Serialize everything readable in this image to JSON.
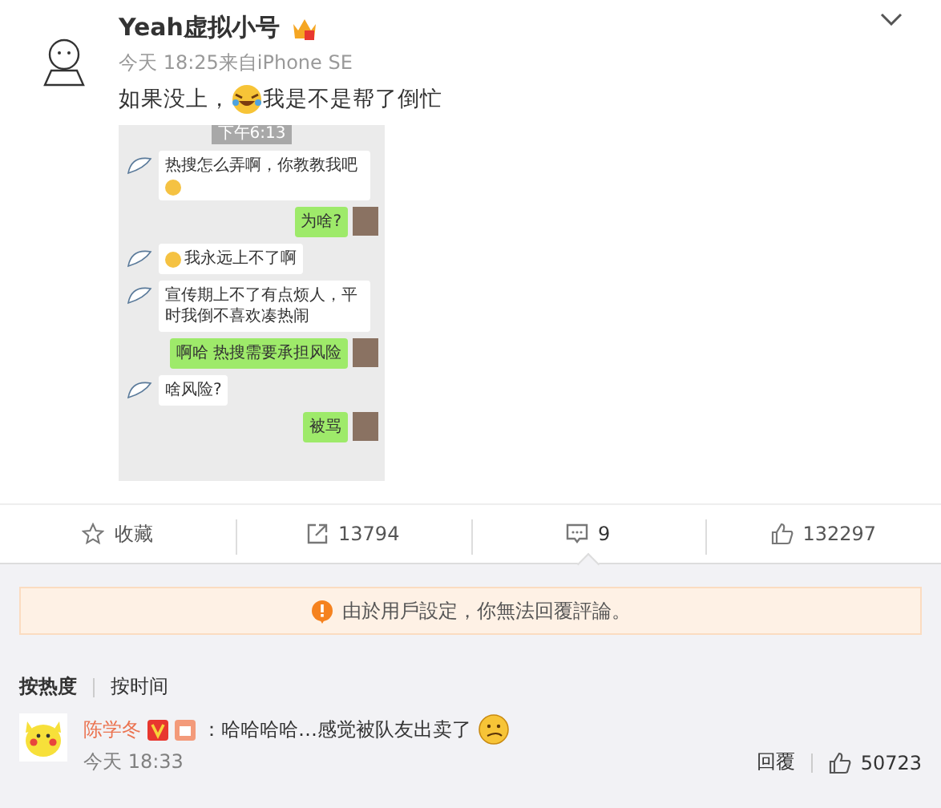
{
  "post": {
    "author": "Yeah虚拟小号",
    "meta": "今天 18:25来自iPhone SE",
    "text_before": "如果没上，",
    "text_after": "我是不是帮了倒忙",
    "chat": {
      "time": "下午6:13",
      "messages": [
        {
          "kind": "in",
          "text": "热搜怎么弄啊，你教教我吧",
          "emoji_before": false,
          "emoji_after": true
        },
        {
          "kind": "out",
          "text": "为啥?",
          "emoji_before": false,
          "emoji_after": false
        },
        {
          "kind": "in",
          "text": "我永远上不了啊",
          "emoji_before": true,
          "emoji_after": false
        },
        {
          "kind": "in",
          "text": "宣传期上不了有点烦人，平时我倒不喜欢凑热闹",
          "emoji_before": false,
          "emoji_after": false
        },
        {
          "kind": "out",
          "text": "啊哈 热搜需要承担风险",
          "emoji_before": false,
          "emoji_after": false
        },
        {
          "kind": "in",
          "text": "啥风险?",
          "emoji_before": false,
          "emoji_after": false
        },
        {
          "kind": "out",
          "text": "被骂",
          "emoji_before": false,
          "emoji_after": false
        }
      ]
    }
  },
  "actions": [
    {
      "kind": "favorite",
      "label": "收藏",
      "selected": false
    },
    {
      "kind": "repost",
      "label": "13794",
      "selected": false
    },
    {
      "kind": "comment",
      "label": "9",
      "selected": true
    },
    {
      "kind": "like",
      "label": "132297",
      "selected": false
    }
  ],
  "notice": "由於用戶設定，你無法回覆評論。",
  "sort_tabs": [
    {
      "label": "按热度",
      "selected": true
    },
    {
      "label": "按时间",
      "selected": false
    }
  ],
  "comments": [
    {
      "author": "陈学冬",
      "text": "：哈哈哈哈…感觉被队友出卖了",
      "time": "今天 18:33",
      "reply": "回覆",
      "likes": "50723"
    }
  ]
}
